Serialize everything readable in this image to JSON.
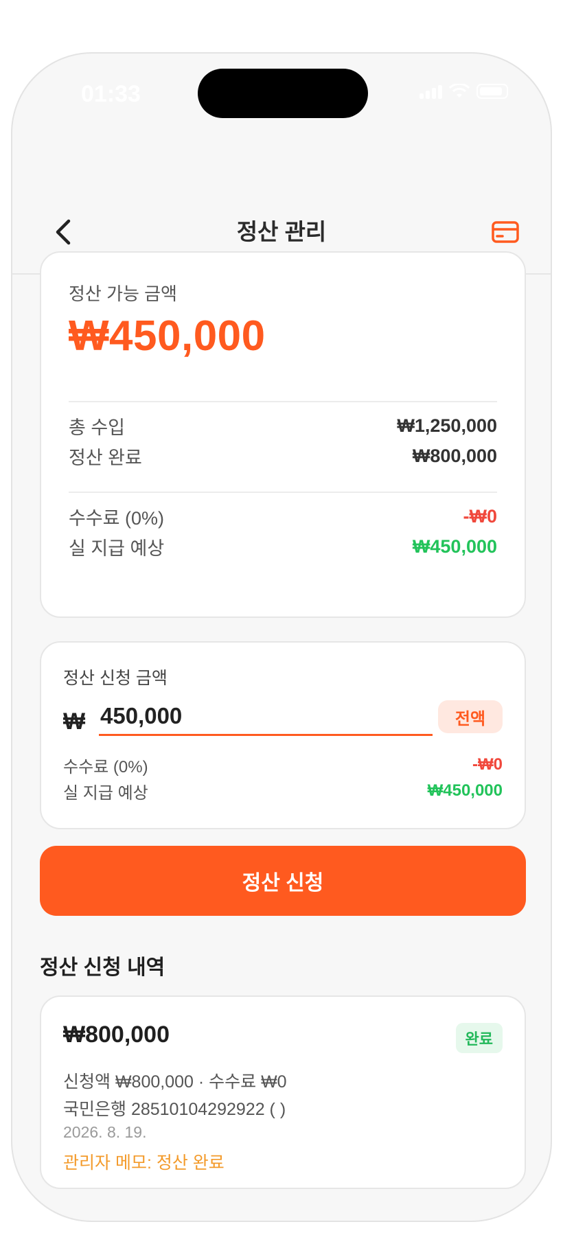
{
  "status_bar": {
    "time": "01:33"
  },
  "header": {
    "title": "정산 관리"
  },
  "summary": {
    "available_label": "정산 가능 금액",
    "available_amount": "₩450,000",
    "rows": [
      {
        "label": "총 수입",
        "value": "₩1,250,000"
      },
      {
        "label": "정산 완료",
        "value": "₩800,000"
      },
      {
        "label": "수수료 (0%)",
        "value": "-₩0"
      },
      {
        "label": "실 지급 예상",
        "value": "₩450,000"
      }
    ]
  },
  "request": {
    "label": "정산 신청 금액",
    "currency": "₩",
    "amount_value": "450,000",
    "full_button": "전액",
    "fee_label": "수수료 (0%)",
    "fee_value": "-₩0",
    "payout_label": "실 지급 예상",
    "payout_value": "₩450,000"
  },
  "submit_button": "정산 신청",
  "history": {
    "title": "정산 신청 내역",
    "items": [
      {
        "amount": "₩800,000",
        "status": "완료",
        "detail": "신청액 ₩800,000 · 수수료 ₩0",
        "account": "국민은행 28510104292922 (        )",
        "date": "2026. 8. 19.",
        "memo": "관리자 메모: 정산 완료"
      }
    ]
  },
  "colors": {
    "accent": "#ff5a1f",
    "negative": "#f0483c",
    "positive": "#22c35a",
    "memo": "#f39a2a"
  },
  "icons": {
    "back": "chevron-left-icon",
    "card": "credit-card-icon"
  }
}
